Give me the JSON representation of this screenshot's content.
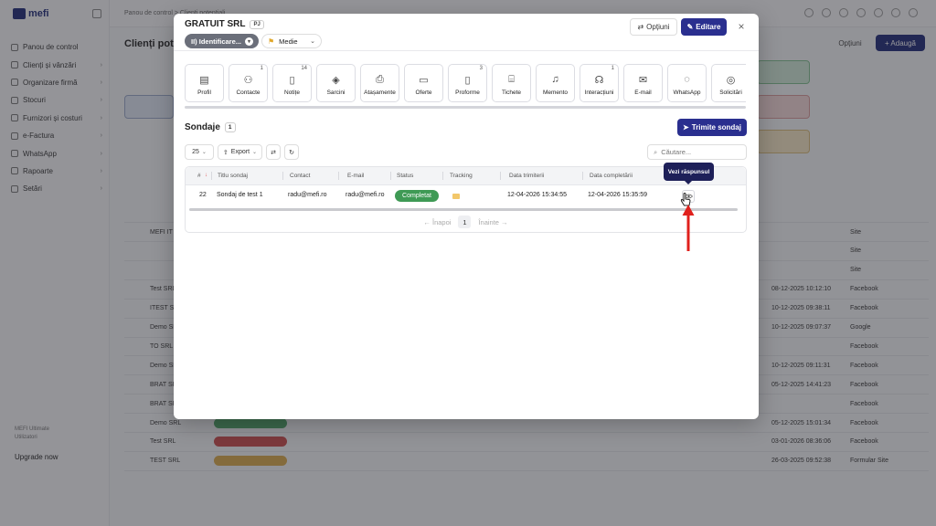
{
  "background": {
    "logo": "mefi",
    "breadcrumb": "Panou de control  >  Clienți potențiali",
    "page_title": "Clienți potențiali",
    "options_label": "Opțiuni",
    "add_label": "+ Adaugă",
    "sidebar": [
      {
        "label": "Panou de control"
      },
      {
        "label": "Clienți și vânzări"
      },
      {
        "label": "Organizare firmă"
      },
      {
        "label": "Stocuri"
      },
      {
        "label": "Furnizori și costuri"
      },
      {
        "label": "e-Factura"
      },
      {
        "label": "WhatsApp"
      },
      {
        "label": "Rapoarte"
      },
      {
        "label": "Setări"
      }
    ],
    "sidebar_footer": "Upgrade now",
    "rows": [
      {
        "name": "MEFI IT",
        "date": "",
        "source": "Site"
      },
      {
        "name": "",
        "date": "",
        "source": "Site"
      },
      {
        "name": "",
        "date": "",
        "source": "Site"
      },
      {
        "name": "Test SRL",
        "date": "08-12-2025 10:12:10",
        "source": "Facebook"
      },
      {
        "name": "ITEST SRL",
        "date": "10-12-2025 09:38:11",
        "source": "Facebook"
      },
      {
        "name": "Demo SRL",
        "date": "10-12-2025 09:07:37",
        "source": "Google"
      },
      {
        "name": "TO SRL",
        "date": "",
        "source": "Facebook"
      },
      {
        "name": "Demo SRL",
        "date": "10-12-2025 09:11:31",
        "source": "Facebook"
      },
      {
        "name": "BRAT SRL",
        "date": "05-12-2025 14:41:23",
        "source": "Facebook"
      },
      {
        "name": "BRAT SRL",
        "date": "",
        "source": "Facebook"
      },
      {
        "name": "Demo SRL",
        "date": "05-12-2025 15:01:34",
        "source": "Facebook"
      },
      {
        "name": "Test SRL",
        "date": "03-01-2026 08:36:06",
        "source": "Facebook"
      },
      {
        "name": "TEST SRL",
        "date": "26-03-2025 09:52:38",
        "source": "Formular Site"
      }
    ]
  },
  "modal": {
    "company": "GRATUIT SRL",
    "company_type": "PJ",
    "stage": "II) Identificare...",
    "priority": "Medie",
    "options_label": "Opțiuni",
    "edit_label": "Editare",
    "close_label": "×",
    "tabs": [
      {
        "label": "Profil",
        "count": "",
        "icon": "profile-icon"
      },
      {
        "label": "Contacte",
        "count": "1",
        "icon": "contacts-icon"
      },
      {
        "label": "Notițe",
        "count": "14",
        "icon": "notes-icon"
      },
      {
        "label": "Sarcini",
        "count": "",
        "icon": "tasks-icon"
      },
      {
        "label": "Atașamente",
        "count": "",
        "icon": "attachments-icon"
      },
      {
        "label": "Oferte",
        "count": "",
        "icon": "offers-icon"
      },
      {
        "label": "Proforme",
        "count": "3",
        "icon": "proforma-icon"
      },
      {
        "label": "Tichete",
        "count": "",
        "icon": "tickets-icon"
      },
      {
        "label": "Memento",
        "count": "",
        "icon": "bell-icon"
      },
      {
        "label": "Interacțiuni",
        "count": "1",
        "icon": "interactions-icon"
      },
      {
        "label": "E-mail",
        "count": "",
        "icon": "mail-icon"
      },
      {
        "label": "WhatsApp",
        "count": "",
        "icon": "whatsapp-icon"
      },
      {
        "label": "Solicitări",
        "count": "",
        "icon": "requests-icon"
      }
    ],
    "section": {
      "title": "Sondaje",
      "count": "1",
      "send_label": "Trimite sondaj"
    },
    "toolbar": {
      "page_size": "25",
      "export_label": "Export",
      "search_placeholder": "Căutare..."
    },
    "table": {
      "headers": [
        "#",
        "Titlu sondaj",
        "Contact",
        "E-mail",
        "Status",
        "Tracking",
        "Data trimiterii",
        "Data completării"
      ],
      "rows": [
        {
          "id": "22",
          "title": "Sondaj de test 1",
          "contact": "radu@mefi.ro",
          "email": "radu@mefi.ro",
          "status": "Completat",
          "sent": "12-04-2026 15:34:55",
          "completed": "12-04-2026 15:35:59"
        }
      ],
      "pager": {
        "prev": "← Înapoi",
        "page": "1",
        "next": "Înainte →"
      }
    },
    "tooltip": "Vezi răspunsul"
  },
  "colors": {
    "primary": "#2a2f8f",
    "status_completed": "#3f9a55",
    "annotation_arrow": "#e0201c",
    "tooltip_bg": "#1e2059"
  }
}
